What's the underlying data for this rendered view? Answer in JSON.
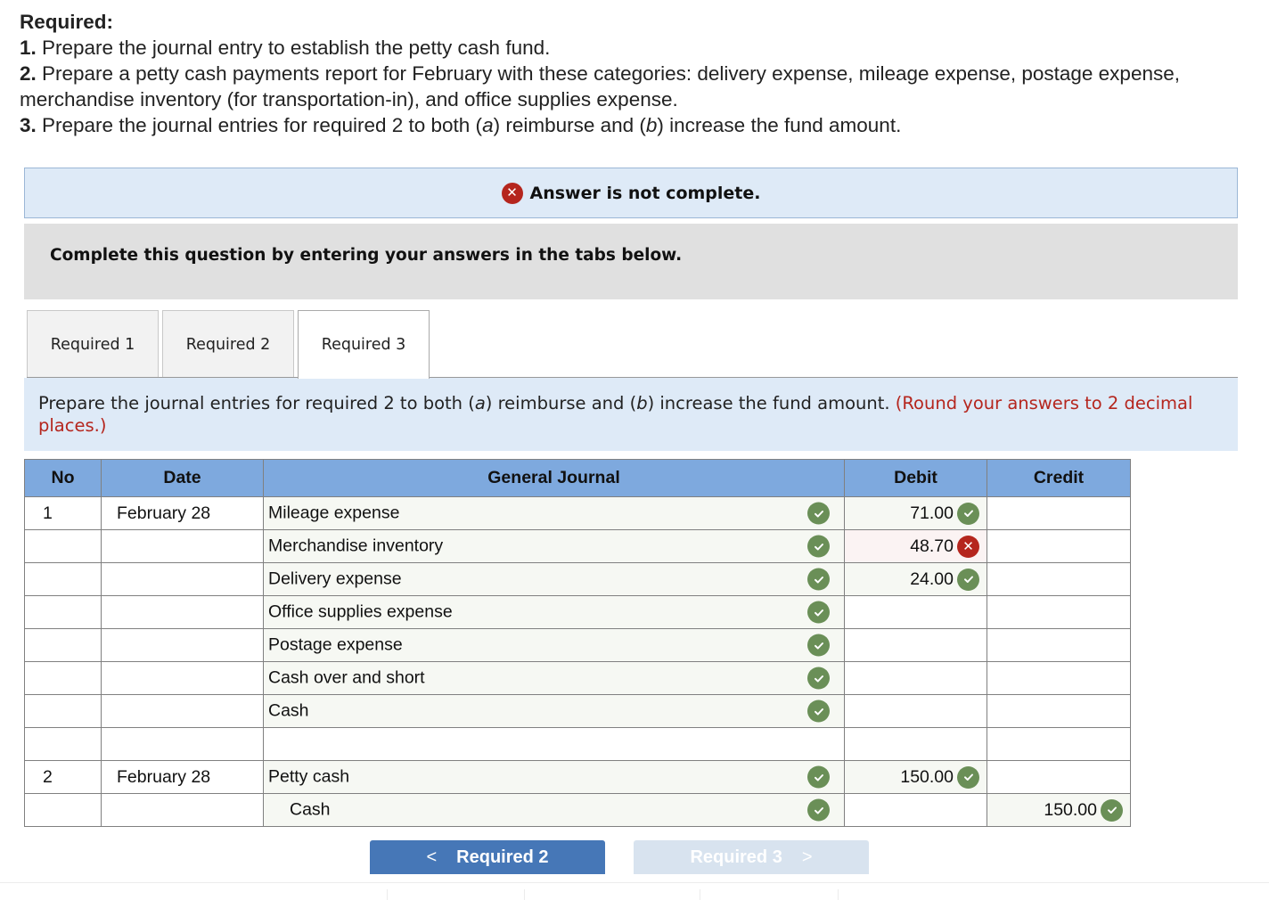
{
  "required": {
    "heading": "Required:",
    "items": [
      {
        "num": "1.",
        "text": " Prepare the journal entry to establish the petty cash fund."
      },
      {
        "num": "2.",
        "text": " Prepare a petty cash payments report for February with these categories: delivery expense, mileage expense, postage expense, merchandise inventory (for transportation-in), and office supplies expense."
      },
      {
        "num": "3.",
        "text_before_a": " Prepare the journal entries for required 2 to both (",
        "a": "a",
        "text_mid": ") reimburse and (",
        "b": "b",
        "text_after": ") increase the fund amount."
      }
    ]
  },
  "banner": {
    "icon": "x-circle-icon",
    "text": "Answer is not complete."
  },
  "complete_box": {
    "text": "Complete this question by entering your answers in the tabs below."
  },
  "tabs": [
    {
      "label": "Required 1",
      "active": false
    },
    {
      "label": "Required 2",
      "active": false
    },
    {
      "label": "Required 3",
      "active": true
    }
  ],
  "instructions": {
    "text_before_a": "Prepare the journal entries for required 2 to both (",
    "a": "a",
    "text_mid": ") reimburse and (",
    "b": "b",
    "text_after": ") increase the fund amount. ",
    "note": "(Round your answers to 2 decimal places.)"
  },
  "journal": {
    "headers": {
      "no": "No",
      "date": "Date",
      "account": "General Journal",
      "debit": "Debit",
      "credit": "Credit"
    },
    "rows": [
      {
        "no": "1",
        "date": "February 28",
        "account": "Mileage expense",
        "account_status": "correct",
        "debit": "71.00",
        "debit_status": "correct",
        "credit": "",
        "credit_status": ""
      },
      {
        "no": "",
        "date": "",
        "account": "Merchandise inventory",
        "account_status": "correct",
        "debit": "48.70",
        "debit_status": "incorrect",
        "credit": "",
        "credit_status": ""
      },
      {
        "no": "",
        "date": "",
        "account": "Delivery expense",
        "account_status": "correct",
        "debit": "24.00",
        "debit_status": "correct",
        "credit": "",
        "credit_status": ""
      },
      {
        "no": "",
        "date": "",
        "account": "Office supplies expense",
        "account_status": "correct",
        "debit": "",
        "debit_status": "",
        "credit": "",
        "credit_status": ""
      },
      {
        "no": "",
        "date": "",
        "account": "Postage expense",
        "account_status": "correct",
        "debit": "",
        "debit_status": "",
        "credit": "",
        "credit_status": ""
      },
      {
        "no": "",
        "date": "",
        "account": "Cash over and short",
        "account_status": "correct",
        "debit": "",
        "debit_status": "",
        "credit": "",
        "credit_status": ""
      },
      {
        "no": "",
        "date": "",
        "account": "Cash",
        "account_status": "correct",
        "debit": "",
        "debit_status": "",
        "credit": "",
        "credit_status": ""
      },
      {
        "no": "",
        "date": "",
        "account": "",
        "account_status": "",
        "debit": "",
        "debit_status": "",
        "credit": "",
        "credit_status": ""
      },
      {
        "no": "2",
        "date": "February 28",
        "account": "Petty cash",
        "account_status": "correct",
        "debit": "150.00",
        "debit_status": "correct",
        "credit": "",
        "credit_status": ""
      },
      {
        "no": "",
        "date": "",
        "account": "Cash",
        "account_indent": true,
        "account_status": "correct",
        "debit": "",
        "debit_status": "",
        "credit": "150.00",
        "credit_status": "correct"
      }
    ]
  },
  "nav": {
    "prev_label": "Required 2",
    "prev_arrow": "<",
    "next_label": "Required 3",
    "next_arrow": ">"
  },
  "colors": {
    "correct": "#6a8f57",
    "incorrect": "#b5261e",
    "header_blue": "#7ea9de",
    "banner_bg": "#deeaf7",
    "nav_active": "#4677b7",
    "nav_disabled": "#d8e3ef"
  }
}
